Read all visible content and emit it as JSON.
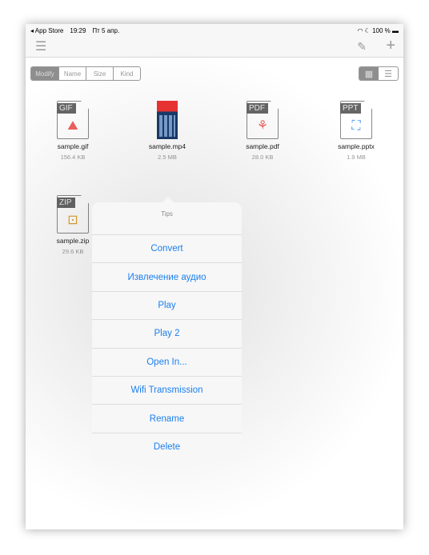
{
  "status": {
    "back": "◂ App Store",
    "time": "19:29",
    "date": "Пт 5 апр.",
    "battery": "100 %"
  },
  "toolbar": {
    "sort": [
      "Modify",
      "Name",
      "Size",
      "Kind"
    ],
    "active_sort": "Modify",
    "view_modes": [
      "grid",
      "list"
    ],
    "active_view": "grid"
  },
  "files": [
    {
      "name": "sample.gif",
      "size": "156.4 KB",
      "tag": "GIF",
      "color": "#f06060"
    },
    {
      "name": "sample.mp4",
      "size": "2.5 MB",
      "tag": "",
      "color": ""
    },
    {
      "name": "sample.pdf",
      "size": "28.0 KB",
      "tag": "PDF",
      "color": "#f06060"
    },
    {
      "name": "sample.pptx",
      "size": "1.9 MB",
      "tag": "PPT",
      "color": "#4a9af0"
    },
    {
      "name": "sample.zip",
      "size": "29.6 KB",
      "tag": "ZIP",
      "color": "#e0a030"
    }
  ],
  "popover": {
    "title": "Tips",
    "items": [
      "Convert",
      "Извлечение аудио",
      "Play",
      "Play 2",
      "Open In...",
      "Wifi Transmission",
      "Rename",
      "Delete"
    ]
  }
}
